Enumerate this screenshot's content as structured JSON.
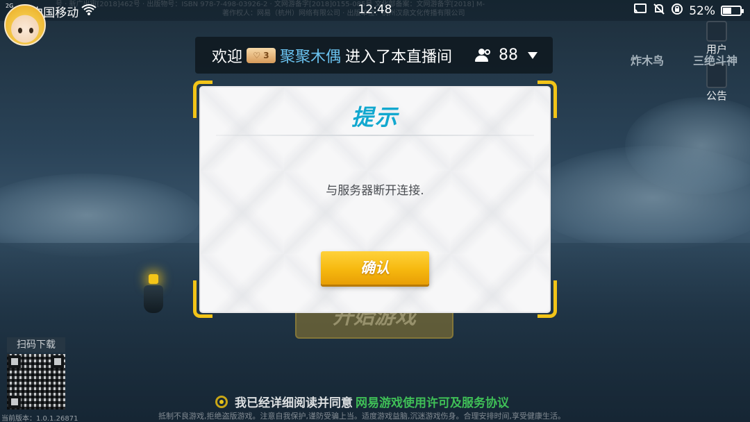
{
  "status_bar": {
    "carrier": "中国移动",
    "network_tag": "2G",
    "time": "12:48",
    "battery_percent": "52%",
    "battery_level": 0.52
  },
  "legal_top": {
    "line1": "号 · 新广出审[2018]462号 · 出版物号：ISBN 978-7-498-03926-2 · 文网游备字[2018]0155-085号 文化部备案：文网游备字[2018] M-",
    "line2": "著作权人：网易（杭州）网络有限公司 · 出版单位：杭州汉鼎文化传播有限公司"
  },
  "side_menu": {
    "user_label": "用户",
    "notice_label": "公告",
    "promo_left": "炸木鸟",
    "promo_right": "三绝斗神"
  },
  "banner": {
    "welcome": "欢迎",
    "badge": "♡ 3",
    "username": "聚聚木偶",
    "suffix": "进入了本直播间",
    "viewer_count": "88"
  },
  "background_button": {
    "label": "开始游戏"
  },
  "dialog": {
    "title": "提示",
    "message": "与服务器断开连接.",
    "confirm_label": "确认"
  },
  "qr": {
    "label": "扫码下载"
  },
  "agreement": {
    "text": "我已经详细阅读并同意",
    "link": "网易游戏使用许可及服务协议"
  },
  "footer": {
    "version": "当前版本：1.0.1.26871",
    "notice": "抵制不良游戏,拒绝盗版游戏。注意自我保护,谨防受骗上当。适度游戏益脑,沉迷游戏伤身。合理安排时间,享受健康生活。"
  },
  "colors": {
    "accent_gold": "#f2c418",
    "title_blue": "#12a8cf",
    "username_blue": "#6ac2ef",
    "link_green": "#3fbf57"
  }
}
